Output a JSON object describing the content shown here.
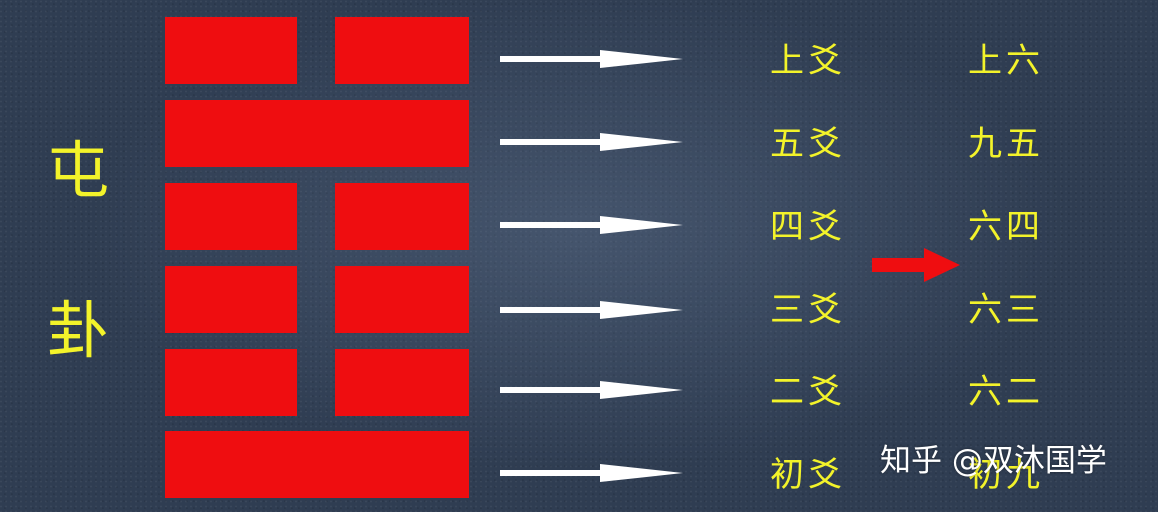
{
  "title_chars": [
    "屯",
    "卦"
  ],
  "lines": [
    {
      "type": "yin",
      "position_name": "上爻",
      "line_name": "上六"
    },
    {
      "type": "yang",
      "position_name": "五爻",
      "line_name": "九五"
    },
    {
      "type": "yin",
      "position_name": "四爻",
      "line_name": "六四"
    },
    {
      "type": "yin",
      "position_name": "三爻",
      "line_name": "六三"
    },
    {
      "type": "yin",
      "position_name": "二爻",
      "line_name": "六二"
    },
    {
      "type": "yang",
      "position_name": "初爻",
      "line_name": "初九"
    }
  ],
  "colors": {
    "background": "#2f3d52",
    "line_red": "#ef0d10",
    "text_yellow": "#f3f32a",
    "arrow_white": "#ffffff"
  },
  "watermark": "知乎 @双沐国学"
}
